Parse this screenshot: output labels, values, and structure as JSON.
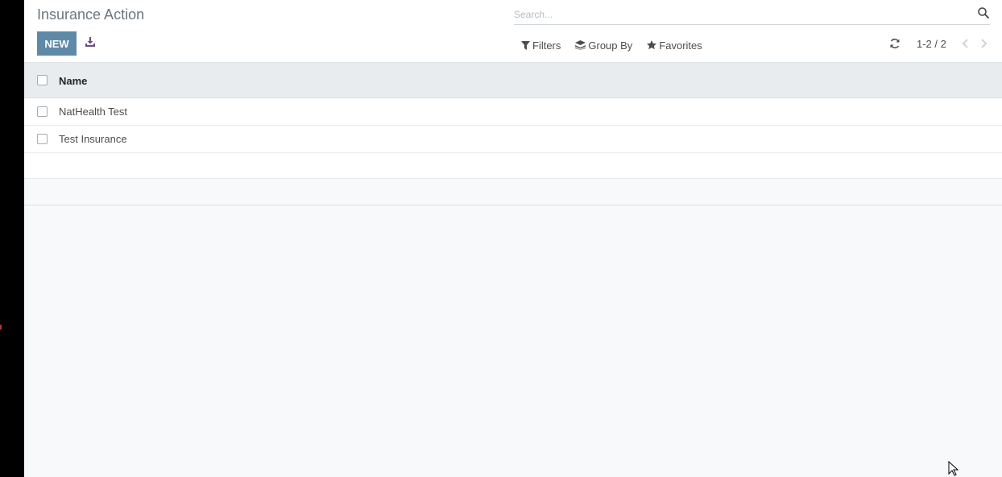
{
  "header": {
    "title": "Insurance Action",
    "new_label": "NEW"
  },
  "search": {
    "placeholder": "Search..."
  },
  "filters": {
    "filters_label": "Filters",
    "groupby_label": "Group By",
    "favorites_label": "Favorites"
  },
  "pager": {
    "value": "1-2 / 2"
  },
  "table": {
    "column_name": "Name",
    "rows": [
      {
        "name": "NatHealth Test"
      },
      {
        "name": "Test Insurance"
      }
    ]
  },
  "colors": {
    "primary": "#5e8aa8",
    "header_bg": "#e9ecef",
    "page_bg": "#f8f9fa"
  }
}
